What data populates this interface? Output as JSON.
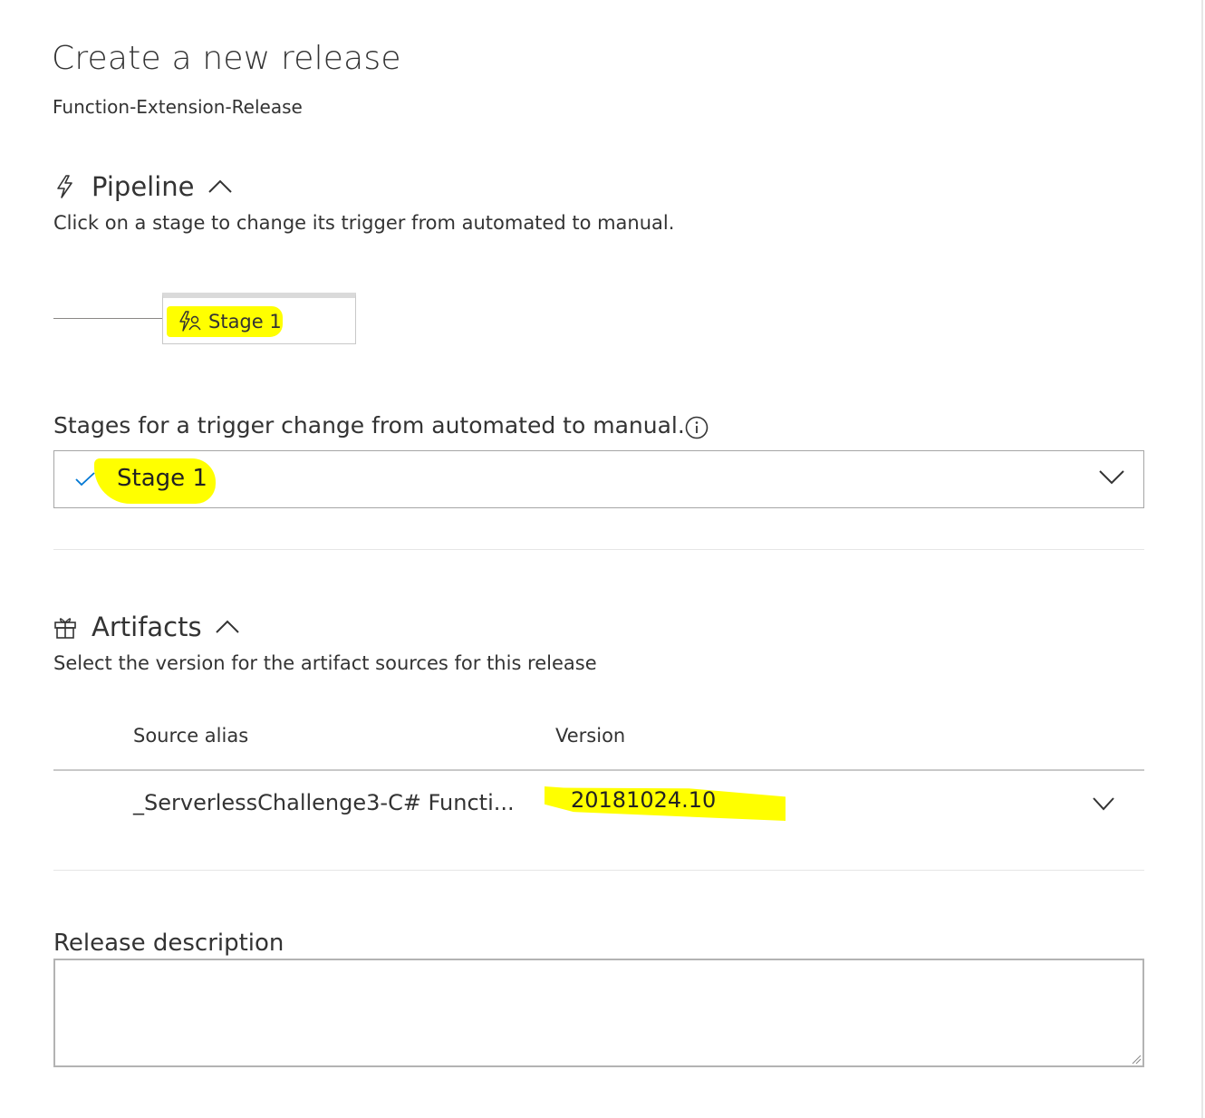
{
  "page": {
    "title": "Create a new release",
    "subtitle": "Function-Extension-Release"
  },
  "pipeline": {
    "icon": "lightning-icon",
    "label": "Pipeline",
    "collapse_icon": "chevron-up-icon",
    "description": "Click on a stage to change its trigger from automated to manual.",
    "stage": {
      "icon": "lightning-person-icon",
      "name": "Stage 1"
    }
  },
  "manual_trigger": {
    "label": "Stages for a trigger change from automated to manual.",
    "info_icon": "info-icon",
    "selected_value": "Stage 1",
    "check_icon": "checkmark-icon",
    "dropdown_icon": "chevron-down-icon"
  },
  "artifacts": {
    "icon": "gift-icon",
    "label": "Artifacts",
    "collapse_icon": "chevron-up-icon",
    "description": "Select the version for the artifact sources for this release",
    "columns": [
      "Source alias",
      "Version"
    ],
    "rows": [
      {
        "source_alias": "_ServerlessChallenge3-C# Functi...",
        "version": "20181024.10"
      }
    ]
  },
  "release_description": {
    "label": "Release description",
    "value": ""
  },
  "colors": {
    "highlight": "#ffff00",
    "accent": "#0078d4",
    "text": "#333333"
  }
}
